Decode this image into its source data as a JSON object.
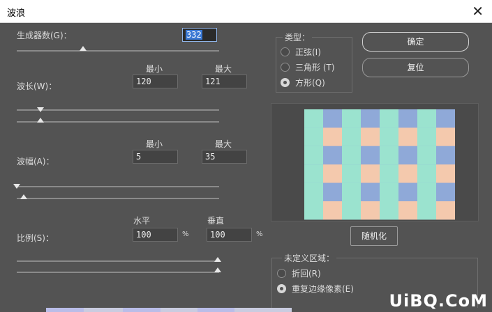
{
  "window": {
    "title": "波浪",
    "close_glyph": "✕"
  },
  "generators": {
    "label": "生成器数(G)：",
    "value": "332"
  },
  "wavelength": {
    "label": "波长(W)：",
    "min_header": "最小",
    "max_header": "最大",
    "min": "120",
    "max": "121"
  },
  "amplitude": {
    "label": "波幅(A)：",
    "min_header": "最小",
    "max_header": "最大",
    "min": "5",
    "max": "35"
  },
  "scale": {
    "label": "比例(S)：",
    "h_header": "水平",
    "v_header": "垂直",
    "h": "100",
    "v": "100",
    "unit": "%"
  },
  "type": {
    "legend": "类型：",
    "options": [
      "正弦(I)",
      "三角形 (T)",
      "方形(Q)"
    ],
    "selected": 2
  },
  "buttons": {
    "ok": "确定",
    "reset": "复位",
    "randomize": "随机化"
  },
  "undefined": {
    "legend": "未定义区域：",
    "options": [
      "折回(R)",
      "重复边缘像素(E)"
    ],
    "selected": 1
  },
  "preview": {
    "colors": {
      "blue": "#8fa9d8",
      "teal": "#9be3cf",
      "peach": "#f4c9ad"
    }
  },
  "watermark": "UiBQ.CoM"
}
